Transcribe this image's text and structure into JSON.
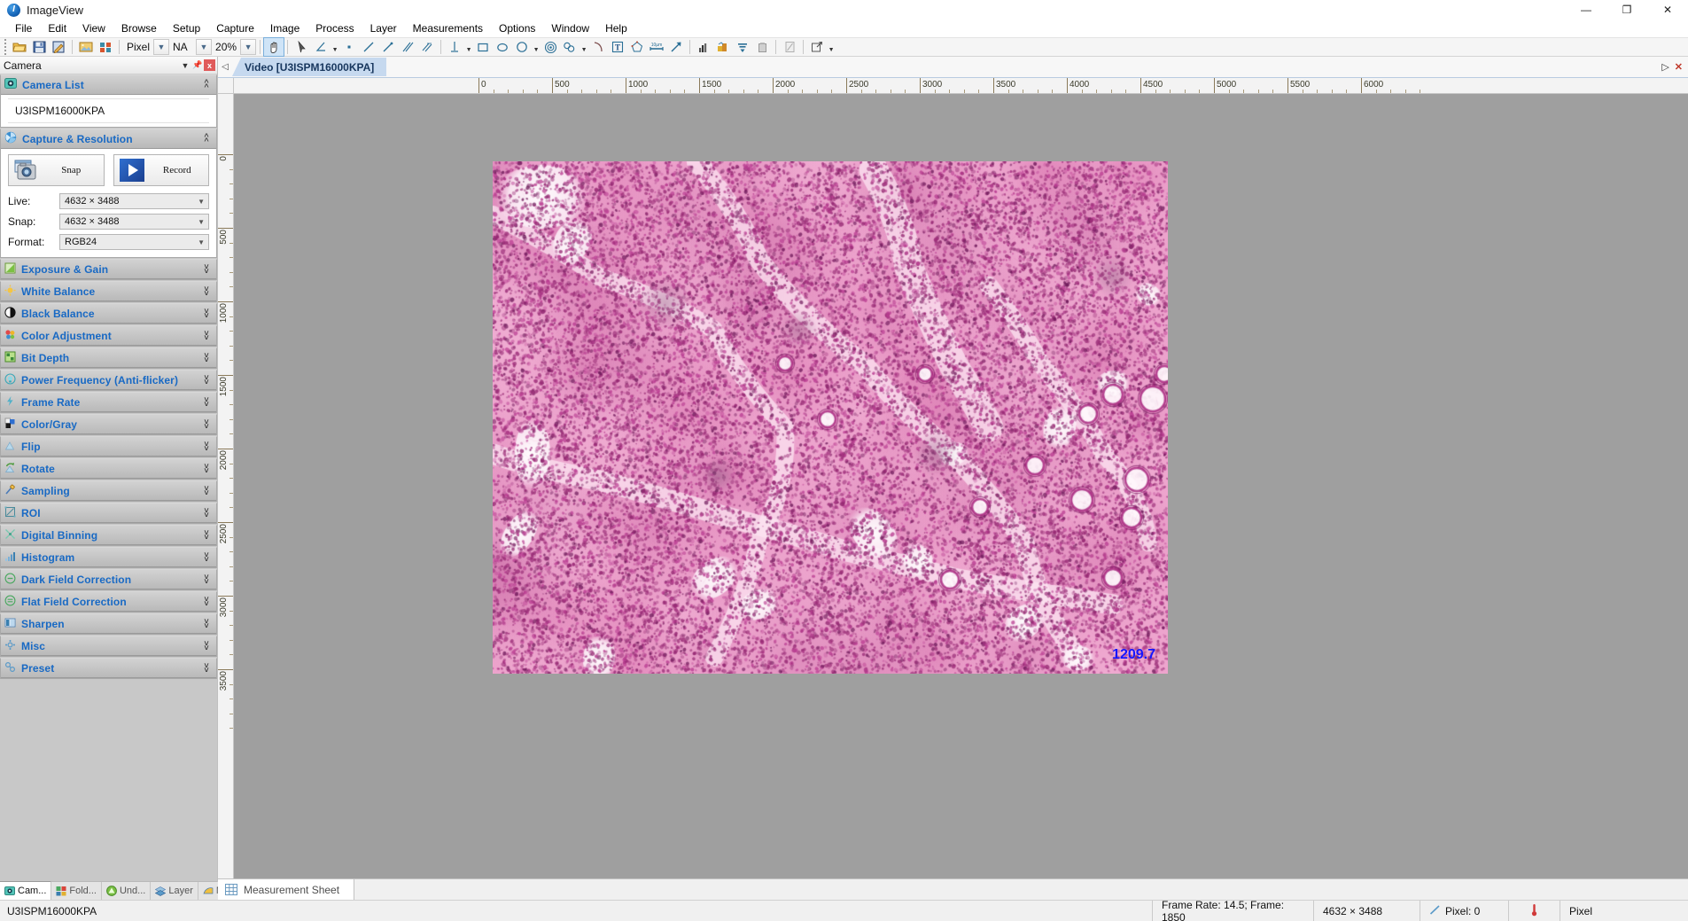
{
  "window": {
    "title": "ImageView",
    "logo_icon": "imageview-logo-icon",
    "minimize": "—",
    "maximize": "❐",
    "close": "✕"
  },
  "menubar": {
    "items": [
      {
        "label": "File"
      },
      {
        "label": "Edit"
      },
      {
        "label": "View"
      },
      {
        "label": "Browse"
      },
      {
        "label": "Setup"
      },
      {
        "label": "Capture"
      },
      {
        "label": "Image"
      },
      {
        "label": "Process"
      },
      {
        "label": "Layer"
      },
      {
        "label": "Measurements"
      },
      {
        "label": "Options"
      },
      {
        "label": "Window"
      },
      {
        "label": "Help"
      }
    ]
  },
  "toolbar": {
    "unit_label": "Pixel",
    "objective_label": "NA",
    "zoom_label": "20%",
    "icons": [
      "open-folder-icon",
      "save-icon",
      "save-as-icon",
      "browse-folder-icon",
      "thumbnail-grid-icon",
      "pan-hand-icon",
      "select-arrow-icon",
      "angle-icon",
      "point-icon",
      "line-icon",
      "arrow-line-icon",
      "parallel-lines-icon",
      "parallel-pair-icon",
      "vertical-line-icon",
      "rectangle-icon",
      "ellipse-icon",
      "circle-icon",
      "concentric-circle-icon",
      "annulus-icon",
      "arc-icon",
      "text-icon",
      "polygon-icon",
      "scalebar-icon",
      "arrow-icon",
      "histogram-icon",
      "color-composite-icon",
      "align-icon",
      "delete-icon",
      "edit-icon",
      "export-icon"
    ]
  },
  "left_panel": {
    "caption": "Camera",
    "caption_buttons": [
      "dropdown-icon",
      "pin-icon",
      "close-icon"
    ],
    "groups": [
      {
        "title": "Camera List",
        "icon": "camera-icon",
        "expanded": true
      },
      {
        "title": "Capture & Resolution",
        "icon": "aperture-icon",
        "expanded": true
      },
      {
        "title": "Exposure & Gain",
        "icon": "exposure-icon",
        "expanded": false
      },
      {
        "title": "White Balance",
        "icon": "white-balance-icon",
        "expanded": false
      },
      {
        "title": "Black Balance",
        "icon": "black-balance-icon",
        "expanded": false
      },
      {
        "title": "Color Adjustment",
        "icon": "color-adjustment-icon",
        "expanded": false
      },
      {
        "title": "Bit Depth",
        "icon": "bit-depth-icon",
        "expanded": false
      },
      {
        "title": "Power Frequency (Anti-flicker)",
        "icon": "power-frequency-icon",
        "expanded": false
      },
      {
        "title": "Frame Rate",
        "icon": "frame-rate-icon",
        "expanded": false
      },
      {
        "title": "Color/Gray",
        "icon": "color-gray-icon",
        "expanded": false
      },
      {
        "title": "Flip",
        "icon": "flip-icon",
        "expanded": false
      },
      {
        "title": "Rotate",
        "icon": "rotate-icon",
        "expanded": false
      },
      {
        "title": "Sampling",
        "icon": "sampling-icon",
        "expanded": false
      },
      {
        "title": "ROI",
        "icon": "roi-icon",
        "expanded": false
      },
      {
        "title": "Digital Binning",
        "icon": "digital-binning-icon",
        "expanded": false
      },
      {
        "title": "Histogram",
        "icon": "histogram-icon",
        "expanded": false
      },
      {
        "title": "Dark Field Correction",
        "icon": "dark-field-icon",
        "expanded": false
      },
      {
        "title": "Flat Field Correction",
        "icon": "flat-field-icon",
        "expanded": false
      },
      {
        "title": "Sharpen",
        "icon": "sharpen-icon",
        "expanded": false
      },
      {
        "title": "Misc",
        "icon": "misc-icon",
        "expanded": false
      },
      {
        "title": "Preset",
        "icon": "preset-icon",
        "expanded": false
      }
    ],
    "camera_list": {
      "selected": "U3ISPM16000KPA"
    },
    "capture": {
      "snap_label": "Snap",
      "record_label": "Record",
      "snap_icon": "camera-snap-icon",
      "record_icon": "record-play-icon",
      "live_label": "Live:",
      "live_value": "4632 × 3488",
      "snap_res_label": "Snap:",
      "snap_res_value": "4632 × 3488",
      "format_label": "Format:",
      "format_value": "RGB24"
    },
    "tabs": [
      {
        "label": "Cam...",
        "icon": "camera-icon",
        "active": true
      },
      {
        "label": "Fold...",
        "icon": "folder-icon",
        "active": false
      },
      {
        "label": "Und...",
        "icon": "undo-icon",
        "active": false
      },
      {
        "label": "Layer",
        "icon": "layer-icon",
        "active": false
      },
      {
        "label": "Mea...",
        "icon": "measure-icon",
        "active": false
      }
    ]
  },
  "document": {
    "tab_label": "Video [U3ISPM16000KPA]",
    "scroll_left_icon": "scroll-left-icon",
    "nav_right_icon": "nav-right-icon",
    "close_tab_icon": "close-tab-icon",
    "measurement_annotation": "1209.7",
    "annotation_color": "#1414ff"
  },
  "rulers": {
    "unit": "Pixel",
    "h_labels": [
      "0",
      "500",
      "1000",
      "1500",
      "2000",
      "2500",
      "3000",
      "3500",
      "4000",
      "4500",
      "5000",
      "5500",
      "6000"
    ],
    "v_labels": [
      "0",
      "500",
      "1000",
      "1500",
      "2000",
      "2500",
      "3000",
      "3500"
    ]
  },
  "sheet_bar": {
    "tab_label": "Measurement Sheet",
    "tab_icon": "grid-sheet-icon"
  },
  "statusbar": {
    "left_text": "U3ISPM16000KPA",
    "frame_info": "Frame Rate: 14.5; Frame: 1850",
    "resolution": "4632 × 3488",
    "pixel_info": "Pixel: 0",
    "pixel_icon": "line-measure-icon",
    "temperature_icon": "thermometer-icon",
    "unit": "Pixel"
  },
  "colors": {
    "group_title": "#1869c4",
    "doc_tab_bg": "#c6d9ef",
    "doc_tab_text": "#17365d",
    "annotation": "#1414ff",
    "canvas_bg": "#9f9f9f"
  }
}
